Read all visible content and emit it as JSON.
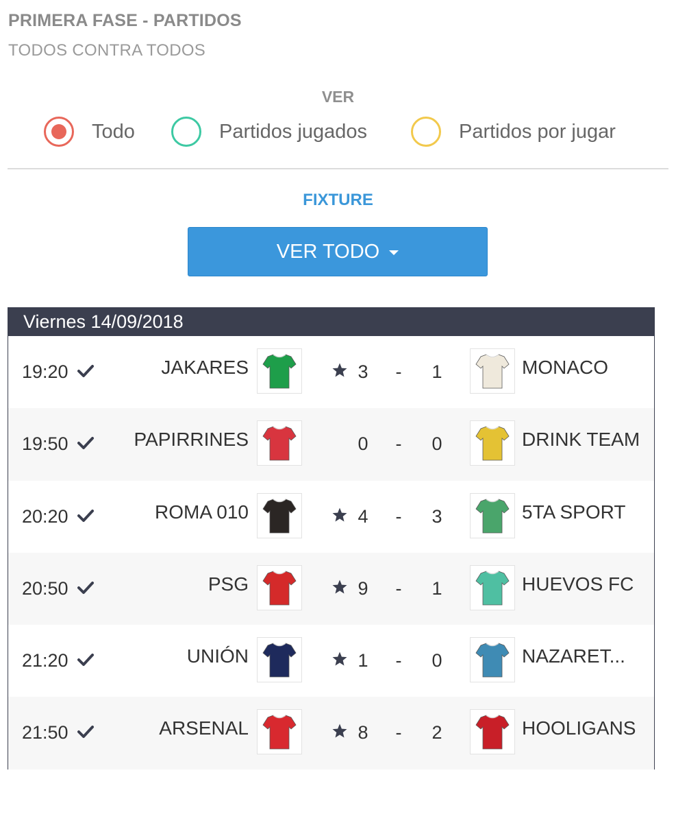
{
  "header": {
    "title": "PRIMERA FASE - PARTIDOS",
    "subtitle": "TODOS CONTRA TODOS"
  },
  "filter": {
    "label": "VER",
    "options": [
      {
        "label": "Todo",
        "selected": true,
        "color": "#e8675a"
      },
      {
        "label": "Partidos jugados",
        "selected": false,
        "color": "#3dc9a3"
      },
      {
        "label": "Partidos por jugar",
        "selected": false,
        "color": "#f2c94c"
      }
    ]
  },
  "fixture": {
    "label": "FIXTURE",
    "label_color": "#3b97d9",
    "button_label": "VER TODO",
    "button_color": "#3b97dc"
  },
  "table": {
    "header_color": "#3b3f4f",
    "date": "Viernes 14/09/2018",
    "matches": [
      {
        "time": "19:20",
        "home": "JAKARES",
        "home_score": "3",
        "separator": "-",
        "away_score": "1",
        "away": "MONACO",
        "winner_star": true,
        "home_shirt": "#1e9e4a",
        "away_shirt": "#efe9dc"
      },
      {
        "time": "19:50",
        "home": "PAPIRRINES",
        "home_score": "0",
        "separator": "-",
        "away_score": "0",
        "away": "DRINK TEAM",
        "winner_star": false,
        "home_shirt": "#d8353f",
        "away_shirt": "#e4c234"
      },
      {
        "time": "20:20",
        "home": "ROMA 010",
        "home_score": "4",
        "separator": "-",
        "away_score": "3",
        "away": "5TA SPORT",
        "winner_star": true,
        "home_shirt": "#2b2624",
        "away_shirt": "#4aa56b"
      },
      {
        "time": "20:50",
        "home": "PSG",
        "home_score": "9",
        "separator": "-",
        "away_score": "1",
        "away": "HUEVOS FC",
        "winner_star": true,
        "home_shirt": "#d42a2a",
        "away_shirt": "#4fbfa2"
      },
      {
        "time": "21:20",
        "home": "UNIÓN",
        "home_score": "1",
        "separator": "-",
        "away_score": "0",
        "away": "NAZARET...",
        "winner_star": true,
        "home_shirt": "#1e2a5c",
        "away_shirt": "#3f8bb4"
      },
      {
        "time": "21:50",
        "home": "ARSENAL",
        "home_score": "8",
        "separator": "-",
        "away_score": "2",
        "away": "HOOLIGANS",
        "winner_star": true,
        "home_shirt": "#d8292f",
        "away_shirt": "#c81f28"
      }
    ]
  }
}
